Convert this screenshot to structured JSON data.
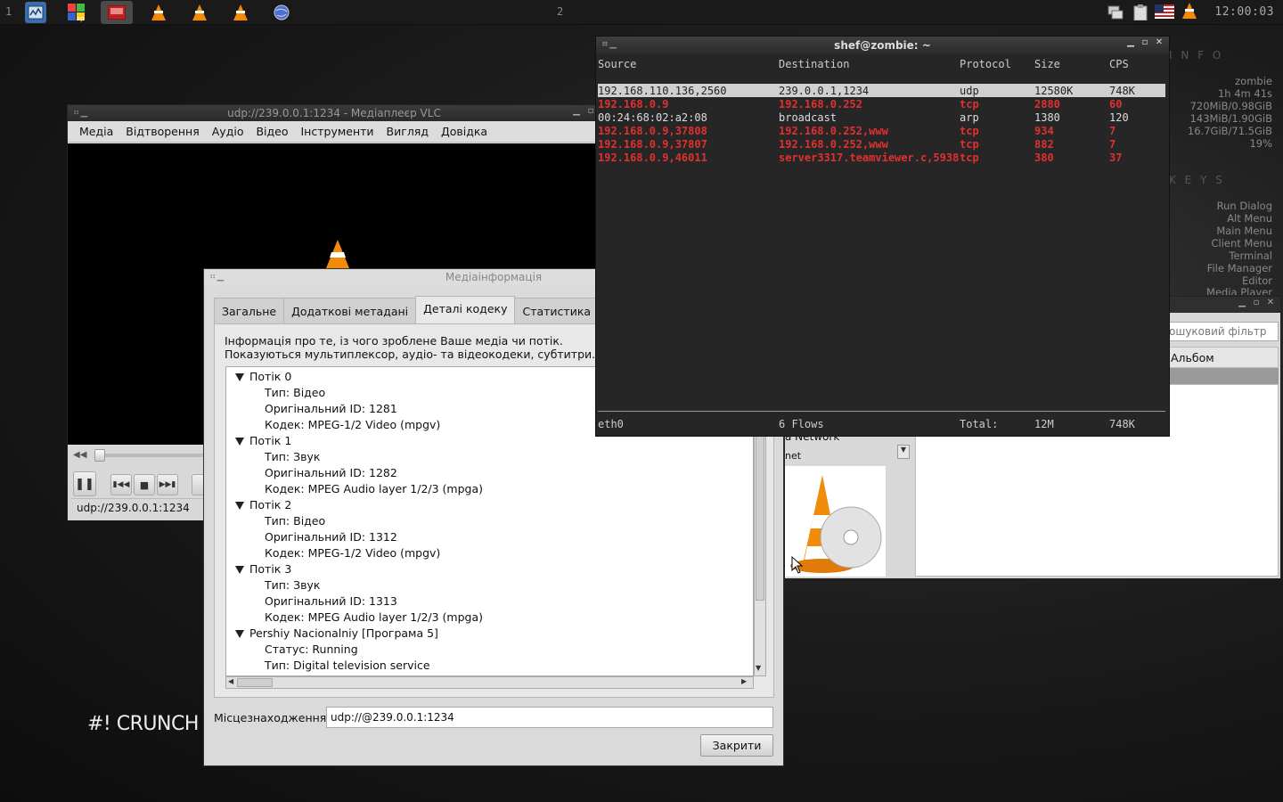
{
  "panel": {
    "workspace_1": "1",
    "workspace_2": "2",
    "clock": "12:00:03"
  },
  "conky": {
    "info_heading": "I N F O",
    "info_lines": [
      "zombie",
      "1h 4m 41s",
      "720MiB/0.98GiB",
      "143MiB/1.90GiB",
      "16.7GiB/71.5GiB",
      "19%"
    ],
    "keys_heading": "K E Y S",
    "key_lines": [
      "Run Dialog",
      "Alt Menu",
      "Main Menu",
      "Client Menu",
      "Terminal",
      "File Manager",
      "Editor",
      "Media Player"
    ]
  },
  "vlc": {
    "title": "udp://239.0.0.1:1234 - Медіаплеєр VLC",
    "menu": [
      "Медіа",
      "Відтворення",
      "Аудіо",
      "Відео",
      "Інструменти",
      "Вигляд",
      "Довідка"
    ],
    "status": "udp://239.0.0.1:1234"
  },
  "mediainfo": {
    "title": "Медіаінформація",
    "tabs": [
      "Загальне",
      "Додаткові метадані",
      "Деталі кодеку",
      "Статистика"
    ],
    "description": [
      "Інформація про те, із чого зроблене Ваше медіа чи потік.",
      "Показуються мультиплексор, аудіо- та відеокодеки, субтитри."
    ],
    "tree": [
      {
        "level": 0,
        "text": "Потік 0"
      },
      {
        "level": 1,
        "text": "Тип: Відео"
      },
      {
        "level": 1,
        "text": "Оригінальний ID: 1281"
      },
      {
        "level": 1,
        "text": "Кодек: MPEG-1/2 Video (mpgv)"
      },
      {
        "level": 0,
        "text": "Потік 1"
      },
      {
        "level": 1,
        "text": "Тип: Звук"
      },
      {
        "level": 1,
        "text": "Оригінальний ID: 1282"
      },
      {
        "level": 1,
        "text": "Кодек: MPEG Audio layer 1/2/3 (mpga)"
      },
      {
        "level": 0,
        "text": "Потік 2"
      },
      {
        "level": 1,
        "text": "Тип: Відео"
      },
      {
        "level": 1,
        "text": "Оригінальний ID: 1312"
      },
      {
        "level": 1,
        "text": "Кодек: MPEG-1/2 Video (mpgv)"
      },
      {
        "level": 0,
        "text": "Потік 3"
      },
      {
        "level": 1,
        "text": "Тип: Звук"
      },
      {
        "level": 1,
        "text": "Оригінальний ID: 1313"
      },
      {
        "level": 1,
        "text": "Кодек: MPEG Audio layer 1/2/3 (mpga)"
      },
      {
        "level": 0,
        "text": "Pershiy Nacionalniy [Програма 5]"
      },
      {
        "level": 1,
        "text": "Статус: Running"
      },
      {
        "level": 1,
        "text": "Тип: Digital television service"
      }
    ],
    "location_label": "Місцезнаходження:",
    "location_value": "udp://@239.0.0.1:1234",
    "close_label": "Закрити"
  },
  "terminal": {
    "title": "shef@zombie: ~",
    "headers": [
      "Source",
      "Destination",
      "Protocol",
      "Size",
      "CPS"
    ],
    "rows": [
      {
        "style": "selected",
        "cells": [
          "192.168.110.136,2560",
          "239.0.0.1,1234",
          "udp",
          "12580K",
          "748K"
        ]
      },
      {
        "style": "red",
        "cells": [
          "192.168.0.9",
          "192.168.0.252",
          "tcp",
          "2880",
          "60"
        ]
      },
      {
        "style": "white",
        "cells": [
          "00:24:68:02:a2:08",
          "broadcast",
          "arp",
          "1380",
          "120"
        ]
      },
      {
        "style": "red",
        "cells": [
          "192.168.0.9,37808",
          "192.168.0.252,www",
          "tcp",
          "934",
          "7"
        ]
      },
      {
        "style": "red",
        "cells": [
          "192.168.0.9,37807",
          "192.168.0.252,www",
          "tcp",
          "882",
          "7"
        ]
      },
      {
        "style": "red",
        "cells": [
          "192.168.0.9,46011",
          "server3317.teamviewer.c,5938",
          "tcp",
          "380",
          "37"
        ]
      }
    ],
    "footer": [
      "eth0",
      "6 Flows",
      "Total:",
      "12M",
      "748K"
    ]
  },
  "library": {
    "search_placeholder": "ошуковий фільтр",
    "column": "Альбом",
    "side_item_1": "a Network",
    "side_item_2": "net"
  },
  "wallpaper": {
    "text": "#! CRUNCH"
  }
}
